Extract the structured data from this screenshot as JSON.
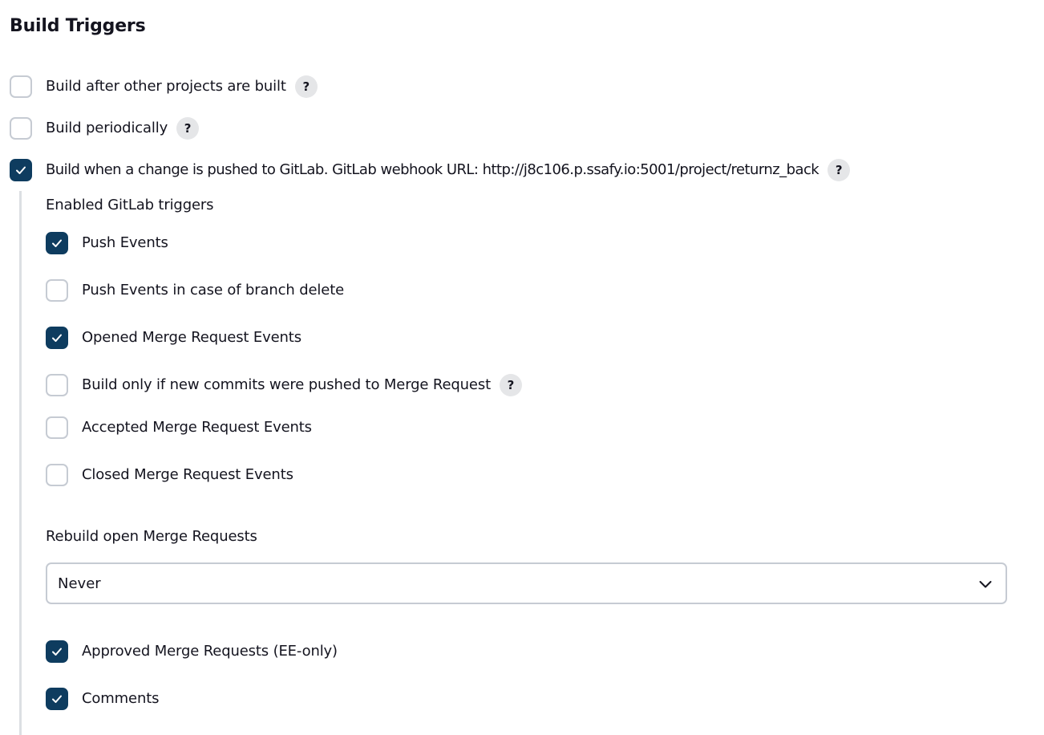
{
  "section": {
    "title": "Build Triggers"
  },
  "triggers": [
    {
      "label": "Build after other projects are built",
      "checked": false,
      "has_help": true
    },
    {
      "label": "Build periodically",
      "checked": false,
      "has_help": true
    },
    {
      "label": "Build when a change is pushed to GitLab. GitLab webhook URL: http://j8c106.p.ssafy.io:5001/project/returnz_back",
      "checked": true,
      "has_help": true
    }
  ],
  "gitlab": {
    "enabled_triggers_label": "Enabled GitLab triggers",
    "events": [
      {
        "label": "Push Events",
        "checked": true,
        "has_help": false
      },
      {
        "label": "Push Events in case of branch delete",
        "checked": false,
        "has_help": false
      },
      {
        "label": "Opened Merge Request Events",
        "checked": true,
        "has_help": false
      },
      {
        "label": "Build only if new commits were pushed to Merge Request",
        "checked": false,
        "has_help": true
      },
      {
        "label": "Accepted Merge Request Events",
        "checked": false,
        "has_help": false
      },
      {
        "label": "Closed Merge Request Events",
        "checked": false,
        "has_help": false
      }
    ],
    "rebuild": {
      "label": "Rebuild open Merge Requests",
      "selected": "Never"
    },
    "extra_events": [
      {
        "label": "Approved Merge Requests (EE-only)",
        "checked": true,
        "has_help": false
      },
      {
        "label": "Comments",
        "checked": true,
        "has_help": false
      }
    ]
  },
  "help_text": "?",
  "icons": {
    "checkbox_check": "check-icon",
    "help": "question-mark-icon",
    "dropdown": "chevron-down-icon"
  },
  "colors": {
    "checked_fill": "#0e3c5f",
    "unchecked_border": "#c6cbd3",
    "help_bg": "#e5e6e8"
  }
}
